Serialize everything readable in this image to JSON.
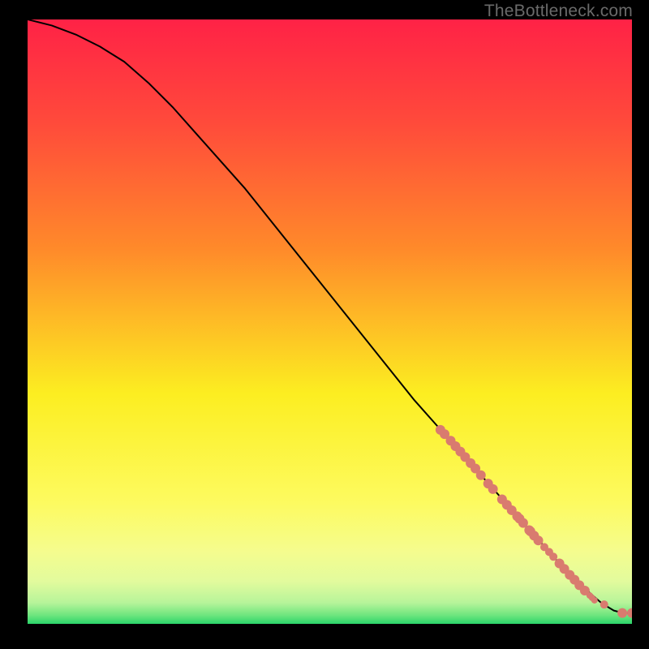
{
  "watermark": "TheBottleneck.com",
  "chart_data": {
    "type": "line",
    "title": "",
    "xlabel": "",
    "ylabel": "",
    "xlim": [
      0,
      100
    ],
    "ylim": [
      0,
      100
    ],
    "grid": false,
    "line": {
      "x": [
        0,
        4,
        8,
        12,
        16,
        20,
        24,
        28,
        32,
        36,
        40,
        44,
        48,
        52,
        56,
        60,
        64,
        68,
        72,
        76,
        80,
        84,
        88,
        92,
        95,
        97,
        98.5,
        100
      ],
      "values": [
        100,
        99,
        97.5,
        95.5,
        93,
        89.5,
        85.5,
        81,
        76.5,
        72,
        67,
        62,
        57,
        52,
        47,
        42,
        37,
        32.5,
        28,
        23.5,
        19,
        14.5,
        10,
        6,
        3.4,
        2.2,
        1.8,
        1.8
      ]
    },
    "points": {
      "x": [
        68.3,
        69.0,
        70.0,
        70.8,
        71.6,
        72.4,
        73.3,
        74.1,
        75.0,
        76.2,
        77.0,
        78.5,
        79.3,
        80.1,
        81.0,
        81.4,
        82.0,
        83.0,
        83.2,
        83.8,
        84.5,
        85.5,
        86.3,
        87.0,
        88.0,
        88.8,
        89.7,
        90.5,
        91.3,
        92.2,
        93.0,
        93.4,
        93.8,
        95.4,
        98.4,
        100.0
      ],
      "y": [
        32.1,
        31.4,
        30.3,
        29.4,
        28.5,
        27.6,
        26.6,
        25.7,
        24.6,
        23.2,
        22.3,
        20.6,
        19.7,
        18.8,
        17.8,
        17.4,
        16.7,
        15.5,
        15.3,
        14.6,
        13.8,
        12.7,
        11.9,
        11.1,
        10.0,
        9.1,
        8.1,
        7.3,
        6.4,
        5.5,
        4.7,
        4.3,
        3.9,
        3.2,
        1.8,
        1.8
      ],
      "r": [
        6,
        6,
        6,
        6,
        6,
        6,
        6,
        6,
        6,
        6,
        6,
        6,
        6,
        6,
        6,
        6,
        6,
        6,
        6,
        6,
        6,
        5,
        5,
        5,
        6,
        6,
        6,
        6,
        6,
        6,
        4,
        4,
        4,
        5,
        6,
        6
      ]
    },
    "colors": {
      "gradient_top": "#ff2246",
      "gradient_mid1": "#ff8a2a",
      "gradient_mid2": "#fcee21",
      "gradient_band": "#e2fb9d",
      "gradient_bottom": "#2bd56a",
      "point_fill": "#d97b6f",
      "line_stroke": "#000000"
    }
  }
}
